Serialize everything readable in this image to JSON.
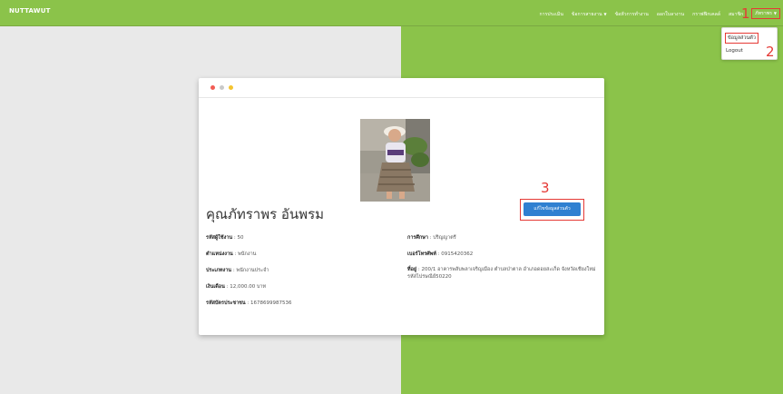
{
  "app": {
    "brand": "NUTTAWUT"
  },
  "nav": {
    "links": [
      "การประเมิน",
      "ข้อการสายงาน",
      "ข้อหัวการทำงาน",
      "ออกใบลางาน",
      "กราฟฟิกเคลล์",
      "สมาชิก"
    ],
    "user": "ภัทราพร"
  },
  "dropdown": {
    "profile": "ข้อมูลส่วนตัว",
    "logout": "Logout"
  },
  "annotations": {
    "a1": "1",
    "a2": "2",
    "a3": "3"
  },
  "profile": {
    "name": "คุณภัทราพร อันพรม",
    "edit_button": "แก้ไขข้อมูลส่วนตัว",
    "employee_id_label": "รหัสผู้ใช้งาน",
    "employee_id": "50",
    "position_label": "ตำแหน่งงาน",
    "position": "พนักงาน",
    "type_label": "ประเภทงาน",
    "type": "พนักงานประจำ",
    "salary_label": "เงินเดือน",
    "salary": "12,000.00 บาท",
    "citizen_label": "รหัสบัตรประชาชน",
    "citizen": "1678699987536",
    "education_label": "การศึกษา",
    "education": "ปริญญาตรี",
    "phone_label": "เบอร์โทรศัพท์",
    "phone": "0915420362",
    "address_label": "ที่อยู่",
    "address": "200/1 อาคารพลับพลาเจริญเมือง ตำบลป่าตาล อำเภอดอยสะเก็ด จังหวัดเชียงใหม่ รหัสไปรษณีย์50220"
  },
  "colors": {
    "accent": "#8bc34a",
    "button": "#2f80d1",
    "annotation": "#e53935"
  }
}
